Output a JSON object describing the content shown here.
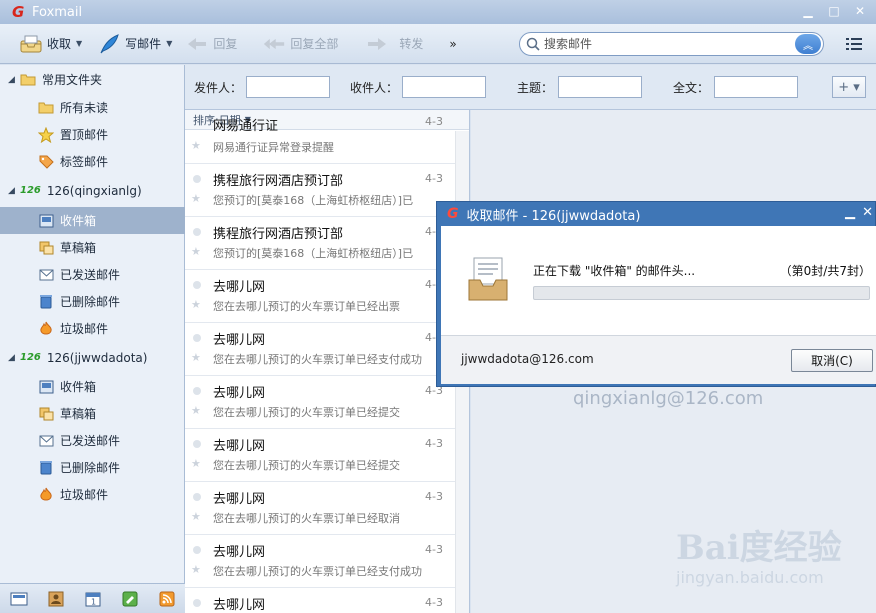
{
  "app": {
    "title": "Foxmail",
    "brand_color": "#d8261c"
  },
  "toolbar": {
    "receive_label": "收取",
    "compose_label": "写邮件",
    "reply_label": "回复",
    "reply_all_label": "回复全部",
    "forward_label": "转发",
    "more_label": "»",
    "search_placeholder": "搜索邮件"
  },
  "sidebar": {
    "common_folder": "常用文件夹",
    "common_items": [
      {
        "label": "所有未读",
        "icon": "folder-icon"
      },
      {
        "label": "置顶邮件",
        "icon": "star-icon"
      },
      {
        "label": "标签邮件",
        "icon": "tag-icon"
      }
    ],
    "accounts": [
      {
        "badge": "126",
        "name": "126(qingxianlg)",
        "folders": [
          "收件箱",
          "草稿箱",
          "已发送邮件",
          "已删除邮件",
          "垃圾邮件"
        ]
      },
      {
        "badge": "126",
        "name": "126(jjwwdadota)",
        "folders": [
          "收件箱",
          "草稿箱",
          "已发送邮件",
          "已删除邮件",
          "垃圾邮件"
        ]
      }
    ]
  },
  "filter": {
    "sender_label": "发件人：",
    "recipient_label": "收件人：",
    "subject_label": "主题：",
    "fulltext_label": "全文：",
    "add_label": "+ ▾"
  },
  "maillist": {
    "sort_label": "排序:日期",
    "items": [
      {
        "from": "网易通行证",
        "date": "4-3",
        "subject": "网易通行证异常登录提醒"
      },
      {
        "from": "携程旅行网酒店预订部",
        "date": "4-3",
        "subject": "您预订的[莫泰168（上海虹桥枢纽店）]已"
      },
      {
        "from": "携程旅行网酒店预订部",
        "date": "4-3",
        "subject": "您预订的[莫泰168（上海虹桥枢纽店）]已"
      },
      {
        "from": "去哪儿网",
        "date": "4-3",
        "subject": "您在去哪儿预订的火车票订单已经出票"
      },
      {
        "from": "去哪儿网",
        "date": "4-3",
        "subject": "您在去哪儿预订的火车票订单已经支付成功"
      },
      {
        "from": "去哪儿网",
        "date": "4-3",
        "subject": "您在去哪儿预订的火车票订单已经提交"
      },
      {
        "from": "去哪儿网",
        "date": "4-3",
        "subject": "您在去哪儿预订的火车票订单已经提交"
      },
      {
        "from": "去哪儿网",
        "date": "4-3",
        "subject": "您在去哪儿预订的火车票订单已经取消"
      },
      {
        "from": "去哪儿网",
        "date": "4-3",
        "subject": "您在去哪儿预订的火车票订单已经支付成功"
      },
      {
        "from": "去哪儿网",
        "date": "4-3",
        "subject": ""
      }
    ]
  },
  "preview": {
    "account_email": "qingxianlg@126.com"
  },
  "watermark": {
    "big": "Bai度经验",
    "small": "jingyan.baidu.com"
  },
  "dialog": {
    "title": "收取邮件 - 126(jjwwdadota)",
    "status": "正在下载 \"收件箱\" 的邮件头...",
    "count": "（第0封/共7封）",
    "progress": 0,
    "account": "jjwwdadota@126.com",
    "cancel_label": "取消(C)"
  }
}
